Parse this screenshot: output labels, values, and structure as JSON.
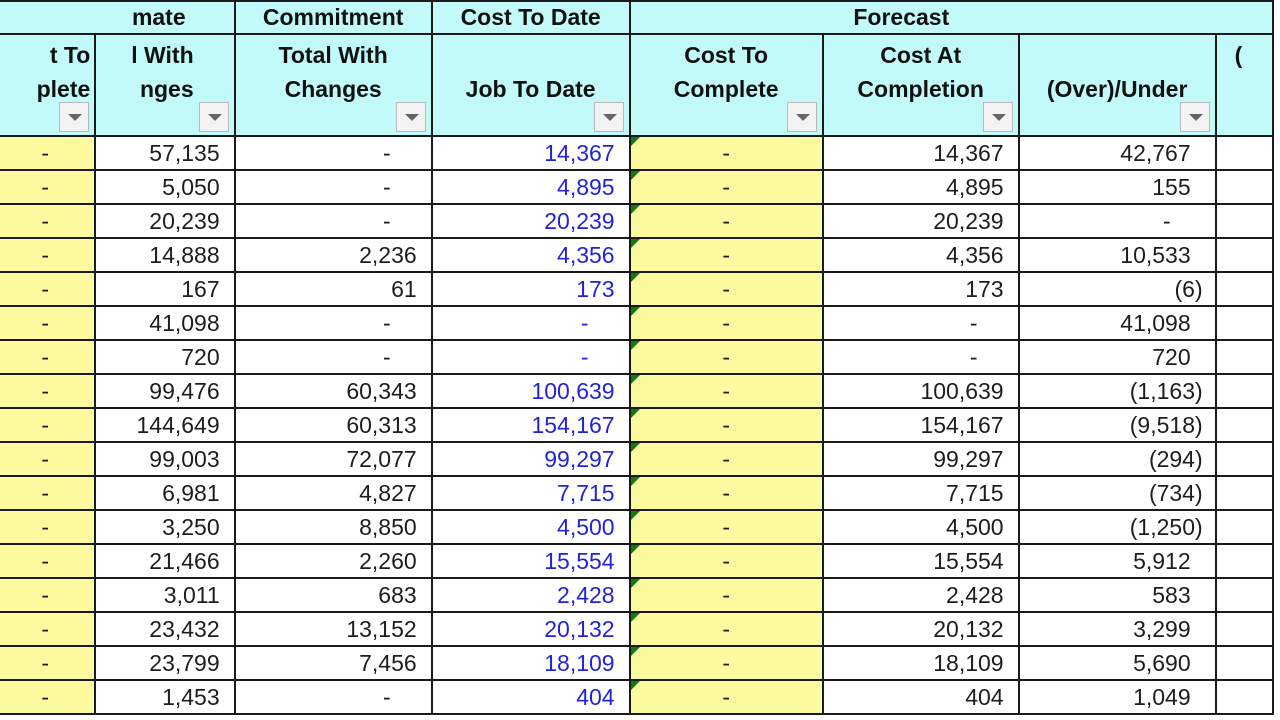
{
  "group_headers": {
    "estimate": "mate",
    "commitment": "Commitment",
    "cost_to_date": "Cost To Date",
    "forecast": "Forecast"
  },
  "columns": [
    {
      "key": "ctc_prev",
      "label": "t To plete"
    },
    {
      "key": "est_total",
      "label": "l With nges"
    },
    {
      "key": "commit_total",
      "label": "Total With Changes"
    },
    {
      "key": "jtd",
      "label": "Job To Date"
    },
    {
      "key": "ctc",
      "label": "Cost To Complete"
    },
    {
      "key": "cac",
      "label": "Cost At Completion"
    },
    {
      "key": "over_under",
      "label": "(Over)/Under"
    },
    {
      "key": "next",
      "label": "("
    }
  ],
  "rows": [
    {
      "ctc_prev": "-",
      "est_total": "57,135",
      "commit_total": "-",
      "jtd": "14,367",
      "ctc": "-",
      "cac": "14,367",
      "over_under": "42,767"
    },
    {
      "ctc_prev": "-",
      "est_total": "5,050",
      "commit_total": "-",
      "jtd": "4,895",
      "ctc": "-",
      "cac": "4,895",
      "over_under": "155"
    },
    {
      "ctc_prev": "-",
      "est_total": "20,239",
      "commit_total": "-",
      "jtd": "20,239",
      "ctc": "-",
      "cac": "20,239",
      "over_under": "-"
    },
    {
      "ctc_prev": "-",
      "est_total": "14,888",
      "commit_total": "2,236",
      "jtd": "4,356",
      "ctc": "-",
      "cac": "4,356",
      "over_under": "10,533"
    },
    {
      "ctc_prev": "-",
      "est_total": "167",
      "commit_total": "61",
      "jtd": "173",
      "ctc": "-",
      "cac": "173",
      "over_under": "(6)"
    },
    {
      "ctc_prev": "-",
      "est_total": "41,098",
      "commit_total": "-",
      "jtd": "-",
      "ctc": "-",
      "cac": "-",
      "over_under": "41,098"
    },
    {
      "ctc_prev": "-",
      "est_total": "720",
      "commit_total": "-",
      "jtd": "-",
      "ctc": "-",
      "cac": "-",
      "over_under": "720"
    },
    {
      "ctc_prev": "-",
      "est_total": "99,476",
      "commit_total": "60,343",
      "jtd": "100,639",
      "ctc": "-",
      "cac": "100,639",
      "over_under": "(1,163)"
    },
    {
      "ctc_prev": "-",
      "est_total": "144,649",
      "commit_total": "60,313",
      "jtd": "154,167",
      "ctc": "-",
      "cac": "154,167",
      "over_under": "(9,518)"
    },
    {
      "ctc_prev": "-",
      "est_total": "99,003",
      "commit_total": "72,077",
      "jtd": "99,297",
      "ctc": "-",
      "cac": "99,297",
      "over_under": "(294)"
    },
    {
      "ctc_prev": "-",
      "est_total": "6,981",
      "commit_total": "4,827",
      "jtd": "7,715",
      "ctc": "-",
      "cac": "7,715",
      "over_under": "(734)"
    },
    {
      "ctc_prev": "-",
      "est_total": "3,250",
      "commit_total": "8,850",
      "jtd": "4,500",
      "ctc": "-",
      "cac": "4,500",
      "over_under": "(1,250)"
    },
    {
      "ctc_prev": "-",
      "est_total": "21,466",
      "commit_total": "2,260",
      "jtd": "15,554",
      "ctc": "-",
      "cac": "15,554",
      "over_under": "5,912"
    },
    {
      "ctc_prev": "-",
      "est_total": "3,011",
      "commit_total": "683",
      "jtd": "2,428",
      "ctc": "-",
      "cac": "2,428",
      "over_under": "583"
    },
    {
      "ctc_prev": "-",
      "est_total": "23,432",
      "commit_total": "13,152",
      "jtd": "20,132",
      "ctc": "-",
      "cac": "20,132",
      "over_under": "3,299"
    },
    {
      "ctc_prev": "-",
      "est_total": "23,799",
      "commit_total": "7,456",
      "jtd": "18,109",
      "ctc": "-",
      "cac": "18,109",
      "over_under": "5,690"
    },
    {
      "ctc_prev": "-",
      "est_total": "1,453",
      "commit_total": "-",
      "jtd": "404",
      "ctc": "-",
      "cac": "404",
      "over_under": "1,049"
    }
  ],
  "colors": {
    "header_bg": "#c2fafa",
    "input_cell_bg": "#fbfa9e",
    "link_value_color": "#2323d6",
    "error_indicator": "#137a13"
  }
}
